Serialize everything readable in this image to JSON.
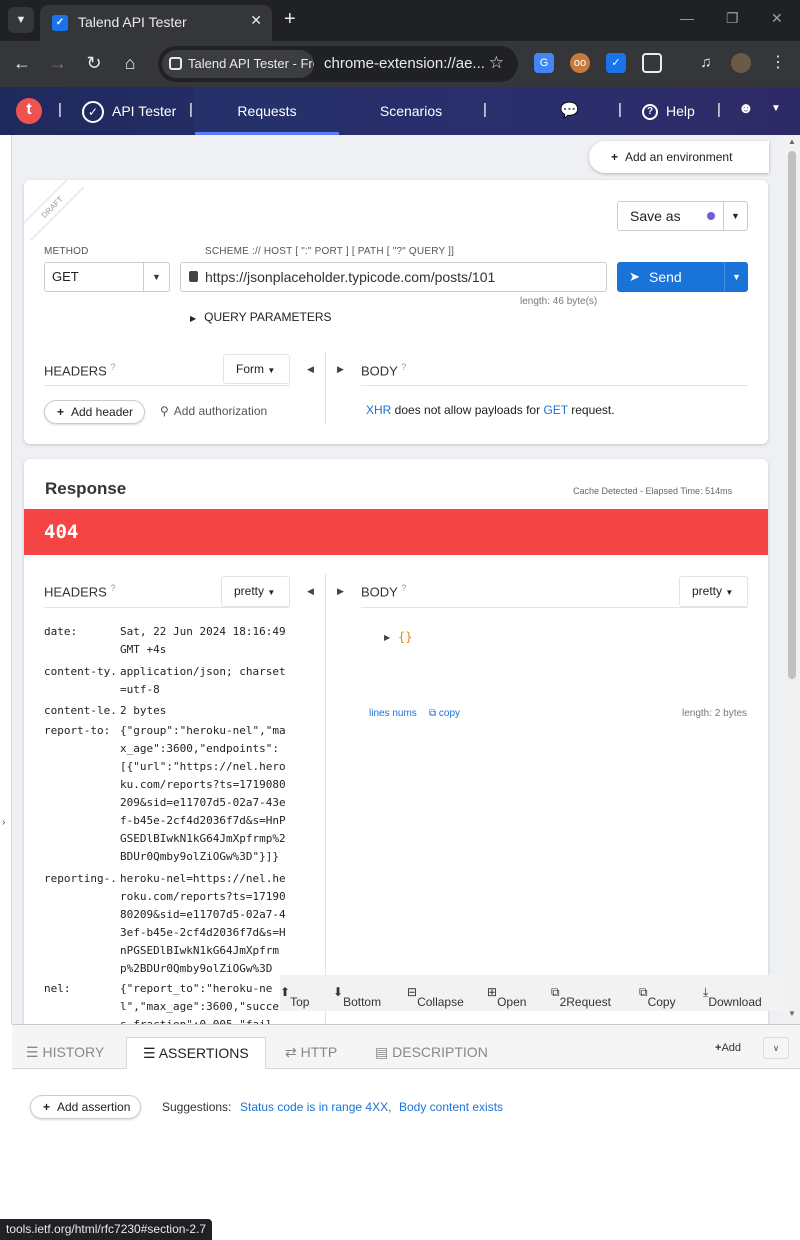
{
  "browser": {
    "tab_title": "Talend API Tester",
    "omnibox_chip": "Talend API Tester - Fre",
    "omnibox_url": "chrome-extension://ae..."
  },
  "app": {
    "brand": "API Tester",
    "nav": {
      "requests": "Requests",
      "scenarios": "Scenarios",
      "help": "Help"
    },
    "add_environment": "Add an environment"
  },
  "request": {
    "draft_label": "DRAFT",
    "save_as_label": "Save as",
    "method_label": "METHOD",
    "method_value": "GET",
    "scheme_label": "SCHEME :// HOST [ \":\" PORT ] [ PATH [ \"?\" QUERY ]]",
    "url": "https://jsonplaceholder.typicode.com/posts/101",
    "send_label": "Send",
    "length_label": "length: 46 byte(s)",
    "query_params_label": "QUERY PARAMETERS",
    "headers_label": "HEADERS",
    "headers_mode": "Form",
    "add_header": "Add header",
    "add_authorization": "Add authorization",
    "body_label": "BODY",
    "body_msg": {
      "xhr": "XHR",
      "middle": " does not allow payloads for ",
      "method": "GET",
      "end": " request."
    }
  },
  "response": {
    "title": "Response",
    "elapsed": "Cache Detected - Elapsed Time: 514ms",
    "status_code": "404",
    "headers_label": "HEADERS",
    "headers_mode": "pretty",
    "body_label": "BODY",
    "body_mode": "pretty",
    "body_content": "{}",
    "lines_nums": "lines nums",
    "copy": "copy",
    "body_length": "length: 2 bytes",
    "headers": [
      {
        "key": "date:",
        "value": "Sat, 22 Jun 2024 18:16:49 GMT +4s"
      },
      {
        "key": "content-ty...",
        "value": "application/json; charset=utf-8"
      },
      {
        "key": "content-le...",
        "value": "2 bytes"
      },
      {
        "key": "report-to:",
        "value": "{\"group\":\"heroku-nel\",\"max_age\":3600,\"endpoints\":[{\"url\":\"https://nel.heroku.com/reports?ts=1719080209&sid=e11707d5-02a7-43ef-b45e-2cf4d2036f7d&s=HnPGSEDlBIwkN1kG64JmXpfrmp%2BDUr0Qmby9olZiOGw%3D\"}]}"
      },
      {
        "key": "reporting-...",
        "value": "heroku-nel=https://nel.heroku.com/reports?ts=1719080209&sid=e11707d5-02a7-43ef-b45e-2cf4d2036f7d&s=HnPGSEDlBIwkN1kG64JmXpfrmp%2BDUr0Qmby9olZiOGw%3D"
      },
      {
        "key": "nel:",
        "value": "{\"report_to\":\"heroku-nel\",\"max_age\":3600,\"success_fraction\":0.005,\"fail"
      }
    ]
  },
  "floatbar": {
    "top": "Top",
    "bottom": "Bottom",
    "collapse": "Collapse",
    "open": "Open",
    "to_request": "2Request",
    "copy": "Copy",
    "download": "Download"
  },
  "bottom_panel": {
    "tabs": {
      "history": "HISTORY",
      "assertions": "ASSERTIONS",
      "http": "HTTP",
      "description": "DESCRIPTION"
    },
    "add": "Add",
    "add_assertion": "Add assertion",
    "suggestions_label": "Suggestions:",
    "suggestion_1": "Status code is in range 4XX,",
    "suggestion_2": "Body content exists"
  },
  "status_url": "tools.ietf.org/html/rfc7230#section-2.7",
  "colors": {
    "accent": "#1a73d9",
    "error": "#f44444",
    "header_bg": "#1f2a5c"
  }
}
